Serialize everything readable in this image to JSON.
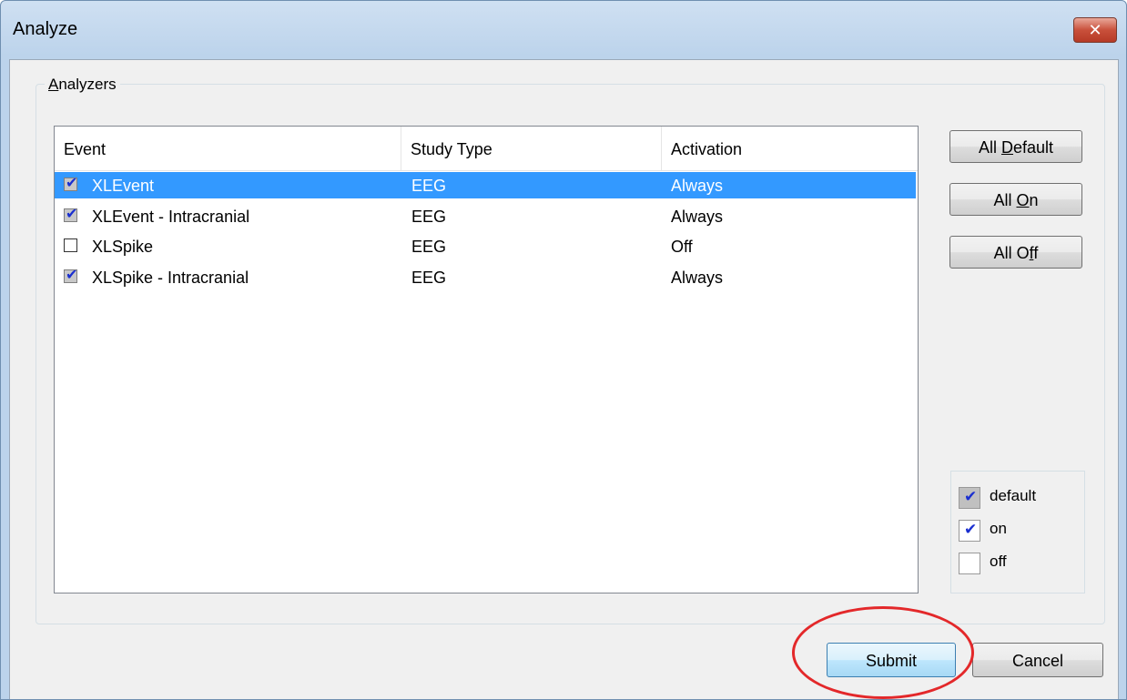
{
  "window": {
    "title": "Analyze",
    "close_glyph": "✕"
  },
  "group": {
    "label_prefix": "",
    "label_accel": "A",
    "label_rest": "nalyzers"
  },
  "listview": {
    "columns": [
      "Event",
      "Study Type",
      "Activation"
    ],
    "rows": [
      {
        "event": "XLEvent",
        "study_type": "EEG",
        "activation": "Always",
        "state": "default",
        "mark": "✔",
        "selected": true
      },
      {
        "event": "XLEvent - Intracranial",
        "study_type": "EEG",
        "activation": "Always",
        "state": "default",
        "mark": "✔",
        "selected": false
      },
      {
        "event": "XLSpike",
        "study_type": "EEG",
        "activation": "Off",
        "state": "off",
        "mark": "",
        "selected": false
      },
      {
        "event": "XLSpike - Intracranial",
        "study_type": "EEG",
        "activation": "Always",
        "state": "default",
        "mark": "✔",
        "selected": false
      }
    ]
  },
  "side_buttons": {
    "all_default": {
      "pre": "All ",
      "accel": "D",
      "post": "efault"
    },
    "all_on": {
      "pre": "All ",
      "accel": "O",
      "post": "n"
    },
    "all_off": {
      "pre": "All O",
      "accel": "f",
      "post": "f"
    }
  },
  "legend": {
    "items": [
      {
        "label": "default",
        "mark": "✔",
        "style": "gray"
      },
      {
        "label": "on",
        "mark": "✔",
        "style": "white"
      },
      {
        "label": "off",
        "mark": "",
        "style": "white"
      }
    ]
  },
  "footer": {
    "submit_label": "Submit",
    "cancel_label": "Cancel"
  },
  "colors": {
    "selection": "#3399ff",
    "checkmark": "#1a2fd0",
    "highlight": "#e3282a"
  }
}
